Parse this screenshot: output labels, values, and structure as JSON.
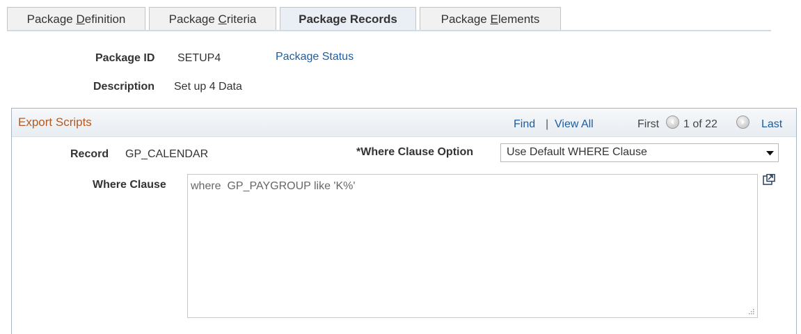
{
  "tabs": [
    {
      "label": "Package Definition",
      "active": false
    },
    {
      "label": "Package Criteria",
      "active": false
    },
    {
      "label": "Package Records",
      "active": true
    },
    {
      "label": "Package Elements",
      "active": false
    }
  ],
  "header": {
    "package_id_label": "Package ID",
    "package_id_value": "SETUP4",
    "package_status_link": "Package Status",
    "description_label": "Description",
    "description_value": "Set up 4 Data"
  },
  "export_scripts": {
    "title": "Export Scripts",
    "nav": {
      "find": "Find",
      "separator": "|",
      "view_all": "View All",
      "first": "First",
      "count": "1 of 22",
      "last": "Last"
    },
    "record_label": "Record",
    "record_value": "GP_CALENDAR",
    "where_option_label": "*Where Clause Option",
    "where_option_value": "Use Default WHERE Clause",
    "where_clause_label": "Where Clause",
    "where_clause_value": "where  GP_PAYGROUP like 'K%'"
  },
  "colors": {
    "link": "#1b5da1",
    "group_title": "#b25a22",
    "active_tab_bg": "#e9eff5"
  },
  "icons": [
    "prev-arrow-icon",
    "next-arrow-icon",
    "dropdown-arrow-icon",
    "expand-popup-icon",
    "resize-grip-icon"
  ]
}
